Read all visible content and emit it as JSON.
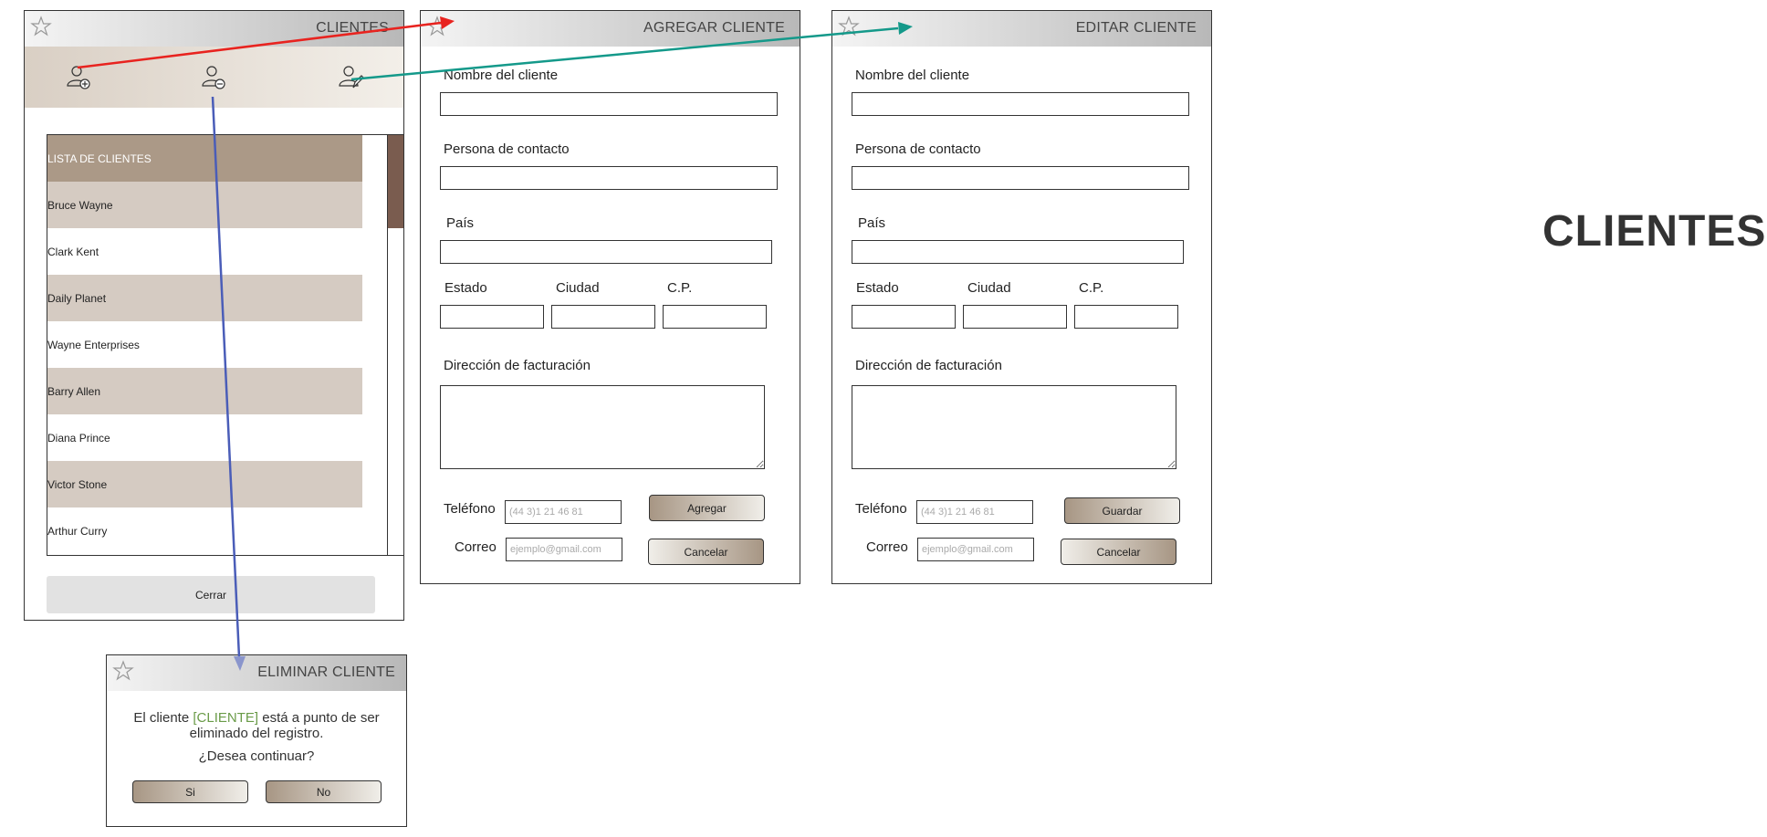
{
  "page_title": "CLIENTES",
  "colors": {
    "red_arrow": "#e8231f",
    "teal_arrow": "#14998a",
    "blue_arrow": "#4a5db8",
    "list_header": "#ab9987",
    "list_alt_row": "#d5cbc2",
    "scroll_thumb": "#7a5c4f",
    "highlight_green": "#6a9b48"
  },
  "clientes": {
    "title": "CLIENTES",
    "icons": [
      "add-user-icon",
      "remove-user-icon",
      "edit-user-icon"
    ],
    "list_header": "LISTA DE CLIENTES",
    "rows": [
      "Bruce Wayne",
      "Clark Kent",
      "Daily Planet",
      "Wayne Enterprises",
      "Barry Allen",
      "Diana Prince",
      "Victor Stone",
      "Arthur Curry"
    ],
    "close_label": "Cerrar"
  },
  "agregar": {
    "title": "AGREGAR CLIENTE",
    "name_label": "Nombre del cliente",
    "contact_label": "Persona de contacto",
    "country_label": "País",
    "state_label": "Estado",
    "city_label": "Ciudad",
    "zip_label": "C.P.",
    "billing_label": "Dirección de facturación",
    "phone_label": "Teléfono",
    "phone_placeholder": "(44 3)1 21 46 81",
    "email_label": "Correo",
    "email_placeholder": "ejemplo@gmail.com",
    "primary_button": "Agregar",
    "cancel_button": "Cancelar"
  },
  "editar": {
    "title": "EDITAR CLIENTE",
    "name_label": "Nombre del cliente",
    "contact_label": "Persona de contacto",
    "country_label": "País",
    "state_label": "Estado",
    "city_label": "Ciudad",
    "zip_label": "C.P.",
    "billing_label": "Dirección de facturación",
    "phone_label": "Teléfono",
    "phone_placeholder": "(44 3)1 21 46 81",
    "email_label": "Correo",
    "email_placeholder": "ejemplo@gmail.com",
    "primary_button": "Guardar",
    "cancel_button": "Cancelar"
  },
  "eliminar": {
    "title": "ELIMINAR CLIENTE",
    "msg_before": "El cliente ",
    "msg_highlight": "[CLIENTE]",
    "msg_after": " está a punto de ser",
    "msg_line2": "eliminado del registro.",
    "question": "¿Desea continuar?",
    "yes_button": "Si",
    "no_button": "No"
  }
}
